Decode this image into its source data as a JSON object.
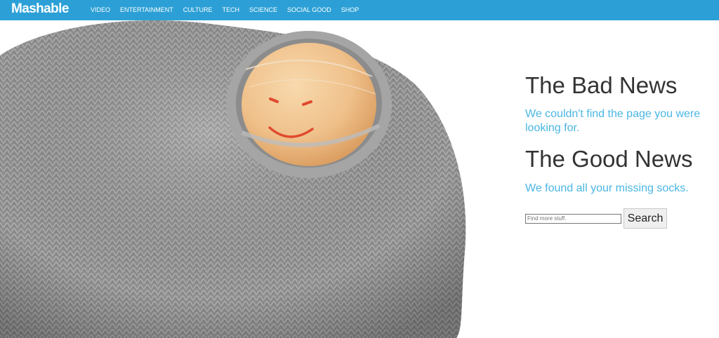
{
  "header": {
    "logo": "Mashable",
    "nav": [
      "VIDEO",
      "ENTERTAINMENT",
      "CULTURE",
      "TECH",
      "SCIENCE",
      "SOCIAL GOOD",
      "SHOP"
    ],
    "bar_color": "#2ca0d6"
  },
  "hero": {
    "description": "grey knit sock with a hole, toe showing with a drawn smiley face"
  },
  "main": {
    "bad_title": "The Bad News",
    "bad_text": "We couldn't find the page you were looking for.",
    "good_title": "The Good News",
    "good_text": "We found all your missing socks."
  },
  "search": {
    "placeholder": "Find more stuff.",
    "button_label": "Search"
  },
  "colors": {
    "accent": "#4ab6e4",
    "heading": "#333333"
  }
}
